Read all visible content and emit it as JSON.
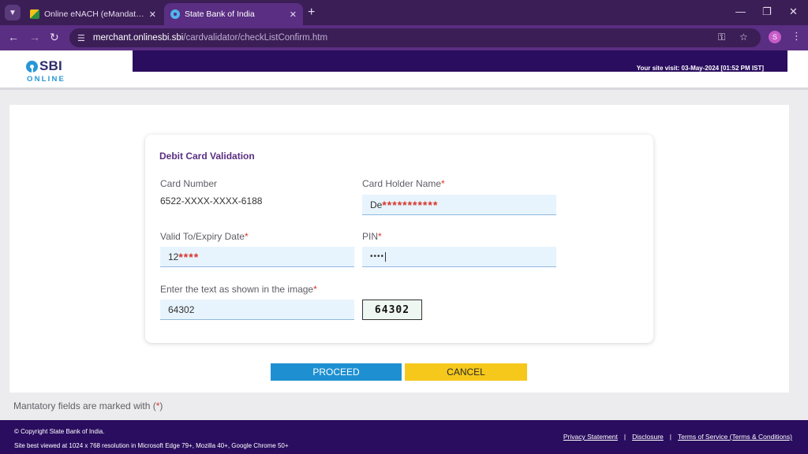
{
  "browser": {
    "tabs": [
      {
        "title": "Online eNACH (eMandate) | Ot",
        "active": false
      },
      {
        "title": "State Bank of India",
        "active": true
      }
    ],
    "new_tab_icon": "plus-icon",
    "url_host": "merchant.onlinesbi.sbi",
    "url_path": "/cardvalidator/checkListConfirm.htm",
    "profile_initial": "S"
  },
  "header": {
    "logo_text": "SBI",
    "logo_sub": "ONLINE",
    "visit_text": "Your site visit: 03-May-2024 [01:52 PM IST]"
  },
  "form": {
    "title": "Debit Card Validation",
    "card_number_label": "Card Number",
    "card_number_value": "6522-XXXX-XXXX-6188",
    "holder_label": "Card Holder Name",
    "holder_prefix": "De",
    "holder_mask": "***********",
    "expiry_label": "Valid To/Expiry Date",
    "expiry_prefix": "12",
    "expiry_mask": "****",
    "pin_label": "PIN",
    "pin_value": "••••",
    "captcha_label": "Enter the text as shown in the image",
    "captcha_input": "64302",
    "captcha_image_text": "64302",
    "required_marker": "*"
  },
  "buttons": {
    "proceed": "PROCEED",
    "cancel": "CANCEL"
  },
  "note": {
    "text": "Mantatory fields are marked with (",
    "star": "*",
    "close": ")"
  },
  "footer": {
    "copyright": "© Copyright State Bank of India.",
    "best_viewed": "Site best viewed at 1024 x 768 resolution in Microsoft Edge 79+, Mozilla 40+, Google Chrome 50+",
    "links": [
      "Privacy Statement",
      "Disclosure",
      "Terms of Service (Terms & Conditions)"
    ]
  },
  "colors": {
    "brand_purple": "#2a0d5f",
    "chrome_purple": "#5a2e82",
    "proceed_blue": "#1e90d2",
    "cancel_yellow": "#f6c81c",
    "required_red": "#d9352a"
  }
}
